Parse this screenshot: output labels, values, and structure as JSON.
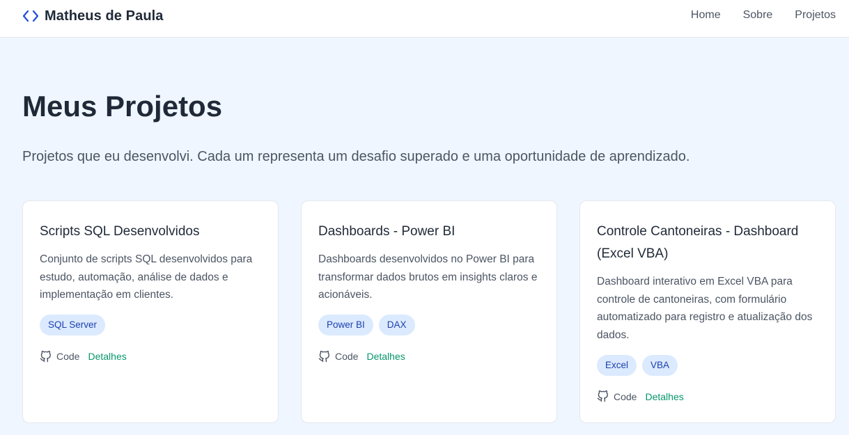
{
  "header": {
    "brand_name": "Matheus de Paula",
    "brand_icon": "code-brackets-icon",
    "accent_color": "#1d4ed8",
    "nav": [
      {
        "label": "Home"
      },
      {
        "label": "Sobre"
      },
      {
        "label": "Projetos"
      }
    ]
  },
  "main": {
    "title": "Meus Projetos",
    "subtitle": "Projetos que eu desenvolvi. Cada um representa um desafio superado e uma oportunidade de aprendizado."
  },
  "projects": [
    {
      "title": "Scripts SQL Desenvolvidos",
      "description": "Conjunto de scripts SQL desenvolvidos para estudo, automação, análise de dados e implementação em clientes.",
      "tags": [
        "SQL Server"
      ],
      "code_label": "Code",
      "details_label": "Detalhes"
    },
    {
      "title": "Dashboards - Power BI",
      "description": "Dashboards desenvolvidos no Power BI para transformar dados brutos em insights claros e acionáveis.",
      "tags": [
        "Power BI",
        "DAX"
      ],
      "code_label": "Code",
      "details_label": "Detalhes"
    },
    {
      "title": "Controle Cantoneiras - Dashboard (Excel VBA)",
      "description": "Dashboard interativo em Excel VBA para controle de cantoneiras, com formulário automatizado para registro e atualização dos dados.",
      "tags": [
        "Excel",
        "VBA"
      ],
      "code_label": "Code",
      "details_label": "Detalhes"
    }
  ]
}
